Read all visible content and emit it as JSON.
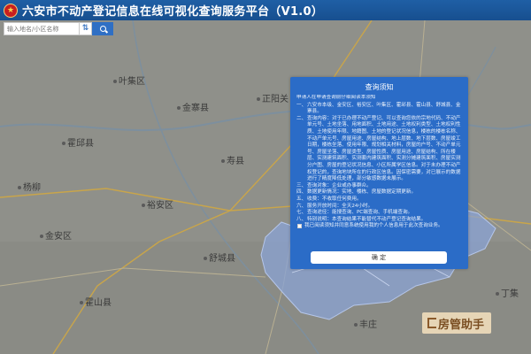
{
  "header": {
    "title": "六安市不动产登记信息在线可视化查询服务平台（V1.0）"
  },
  "search": {
    "placeholder": "输入地名/小区名称",
    "direction_label": "⇅"
  },
  "map": {
    "cities": [
      "叶集区",
      "金寨县",
      "霍邱县",
      "寿县",
      "裕安区",
      "金安区",
      "舒城县",
      "霍山县",
      "正阳关",
      "杨柳",
      "丁集",
      "丰庄"
    ]
  },
  "dialog": {
    "title": "查询须知",
    "intro": "申请人在申请查询前仔细阅读本须知",
    "items": [
      {
        "num": "一、",
        "text": "六安市本级、金安区、裕安区、叶集区、霍邱县、霍山县、舒城县、金寨县。"
      },
      {
        "num": "二、",
        "text": "查询内容：对于已办理不动产登记、可以查询您依的宗地代码、不动产单元号、土地坐落、用地面积、土地用途、土地权利类型、土地权利性质、土地使用年限、地籍图、土地的登记状况信息，楼栋的楼栋名称、不动产单元号、房屋用途、房屋结构、地上层数、地下层数、房屋竣工日期，楼栋坐落、使用年限、规划相关材料，房屋的户号、不动产单元号、房屋坐落、房屋类型、房屋性质、房屋用途、房屋结构、所在楼层、实测建筑面积、实测套内建筑面积、实测分摊建筑面积、房屋实测分户图、房屋的登记状况信息、小区所属学区信息。对于未办理不动产权登记的，查询地块所在的行政区信息。因保密需要，对已展示的数据进行了精度降低处理，部分敏感数据未展示。"
      },
      {
        "num": "三、",
        "text": "查询对象：企业或办事群众。"
      },
      {
        "num": "四、",
        "text": "数据更新情况：实地、楼栋、房屋数据定期更新。"
      },
      {
        "num": "五、",
        "text": "收费：不收取任何费用。"
      },
      {
        "num": "六、",
        "text": "服务开放时间：全天24小时。"
      },
      {
        "num": "七、",
        "text": "查询途径：能搜查询、PC端查询、手机端查询。"
      },
      {
        "num": "八、",
        "text": "特别说明：本查询结果不能替代不动产登记查询结果。"
      }
    ],
    "agree_text": "我已阅读须知并同意系统使用我的个人信息用于此次查询业务。",
    "confirm_label": "确 定"
  },
  "watermark": {
    "text": "房管助手"
  }
}
